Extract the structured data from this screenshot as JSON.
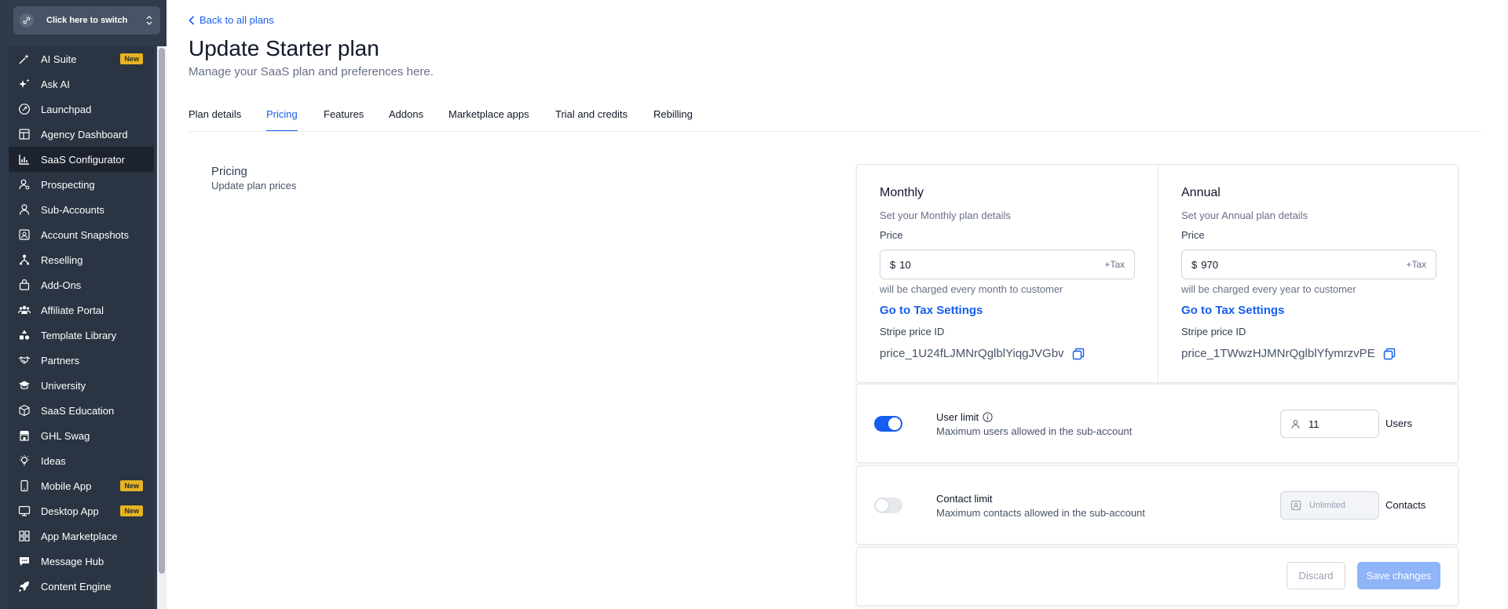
{
  "sidebar": {
    "switcher_label": "Click here to switch",
    "items": [
      {
        "label": "AI Suite",
        "icon": "sparkle-wand-icon",
        "badge": "New"
      },
      {
        "label": "Ask AI",
        "icon": "sparkles-icon"
      },
      {
        "label": "Launchpad",
        "icon": "rocket-circle-icon"
      },
      {
        "label": "Agency Dashboard",
        "icon": "dashboard-icon"
      },
      {
        "label": "SaaS Configurator",
        "icon": "bar-chart-icon",
        "active": true
      },
      {
        "label": "Prospecting",
        "icon": "user-search-icon"
      },
      {
        "label": "Sub-Accounts",
        "icon": "user-icon"
      },
      {
        "label": "Account Snapshots",
        "icon": "snapshot-icon"
      },
      {
        "label": "Reselling",
        "icon": "hierarchy-icon"
      },
      {
        "label": "Add-Ons",
        "icon": "bag-icon"
      },
      {
        "label": "Affiliate Portal",
        "icon": "users-icon"
      },
      {
        "label": "Template Library",
        "icon": "shapes-icon"
      },
      {
        "label": "Partners",
        "icon": "handshake-icon"
      },
      {
        "label": "University",
        "icon": "graduation-cap-icon"
      },
      {
        "label": "SaaS Education",
        "icon": "cube-icon"
      },
      {
        "label": "GHL Swag",
        "icon": "store-icon"
      },
      {
        "label": "Ideas",
        "icon": "lightbulb-icon"
      },
      {
        "label": "Mobile App",
        "icon": "mobile-icon",
        "badge": "New"
      },
      {
        "label": "Desktop App",
        "icon": "desktop-icon",
        "badge": "New"
      },
      {
        "label": "App Marketplace",
        "icon": "grid-icon"
      },
      {
        "label": "Message Hub",
        "icon": "chat-icon"
      },
      {
        "label": "Content Engine",
        "icon": "rocket-icon"
      }
    ]
  },
  "header": {
    "back_label": "Back to all plans",
    "title": "Update Starter plan",
    "subtitle": "Manage your SaaS plan and preferences here."
  },
  "tabs": [
    {
      "label": "Plan details"
    },
    {
      "label": "Pricing",
      "active": true
    },
    {
      "label": "Features"
    },
    {
      "label": "Addons"
    },
    {
      "label": "Marketplace apps"
    },
    {
      "label": "Trial and credits"
    },
    {
      "label": "Rebilling"
    }
  ],
  "pricing_section": {
    "title": "Pricing",
    "description": "Update plan prices"
  },
  "pricing": {
    "monthly": {
      "title": "Monthly",
      "subtitle": "Set your Monthly plan details",
      "price_label": "Price",
      "currency": "$",
      "price_value": "10",
      "tax_suffix": "+Tax",
      "charge_note": "will be charged every month to customer",
      "tax_link": "Go to Tax Settings",
      "stripe_label": "Stripe price ID",
      "stripe_id": "price_1U24fLJMNrQglblYiqgJVGbv"
    },
    "annual": {
      "title": "Annual",
      "subtitle": "Set your Annual plan details",
      "price_label": "Price",
      "currency": "$",
      "price_value": "970",
      "tax_suffix": "+Tax",
      "charge_note": "will be charged every year to customer",
      "tax_link": "Go to Tax Settings",
      "stripe_label": "Stripe price ID",
      "stripe_id": "price_1TWwzHJMNrQglblYfymrzvPE"
    }
  },
  "user_limit": {
    "enabled": true,
    "title": "User limit",
    "description": "Maximum users allowed in the sub-account",
    "value": "11",
    "unit": "Users"
  },
  "contact_limit": {
    "enabled": false,
    "title": "Contact limit",
    "description": "Maximum contacts allowed in the sub-account",
    "placeholder": "Unlimited",
    "unit": "Contacts"
  },
  "actions": {
    "discard_label": "Discard",
    "save_label": "Save changes"
  },
  "colors": {
    "sidebar_bg": "#2f3a4a",
    "accent": "#155eef",
    "badge": "#e6b422",
    "save_disabled": "#8fb4f8"
  }
}
